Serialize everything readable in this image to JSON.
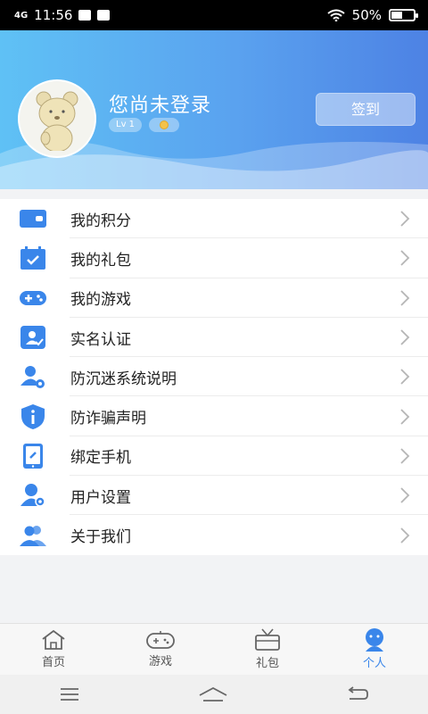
{
  "status_bar": {
    "signal": "4G",
    "time": "11:56",
    "battery_percent": "50%",
    "battery_level": 0.5
  },
  "profile": {
    "username": "您尚未登录",
    "level": "Lv 1",
    "signin_label": "签到"
  },
  "menu": {
    "items": [
      {
        "label": "我的积分",
        "icon": "wallet-icon"
      },
      {
        "label": "我的礼包",
        "icon": "calendar-check-icon"
      },
      {
        "label": "我的游戏",
        "icon": "gamepad-icon"
      },
      {
        "label": "实名认证",
        "icon": "id-card-icon"
      },
      {
        "label": "防沉迷系统说明",
        "icon": "user-settings-icon"
      },
      {
        "label": "防诈骗声明",
        "icon": "shield-info-icon"
      },
      {
        "label": "绑定手机",
        "icon": "phone-link-icon"
      },
      {
        "label": "用户设置",
        "icon": "user-gear-icon"
      },
      {
        "label": "关于我们",
        "icon": "users-icon"
      }
    ]
  },
  "tabbar": {
    "tabs": [
      {
        "label": "首页",
        "icon": "home-icon"
      },
      {
        "label": "游戏",
        "icon": "gamepad-icon"
      },
      {
        "label": "礼包",
        "icon": "tv-gift-icon"
      },
      {
        "label": "个人",
        "icon": "person-icon",
        "active": true
      }
    ]
  },
  "colors": {
    "accent": "#3a86ea",
    "icon_blue": "#3a86ea",
    "header_start": "#5fc1f5",
    "header_end": "#4d82e4"
  }
}
